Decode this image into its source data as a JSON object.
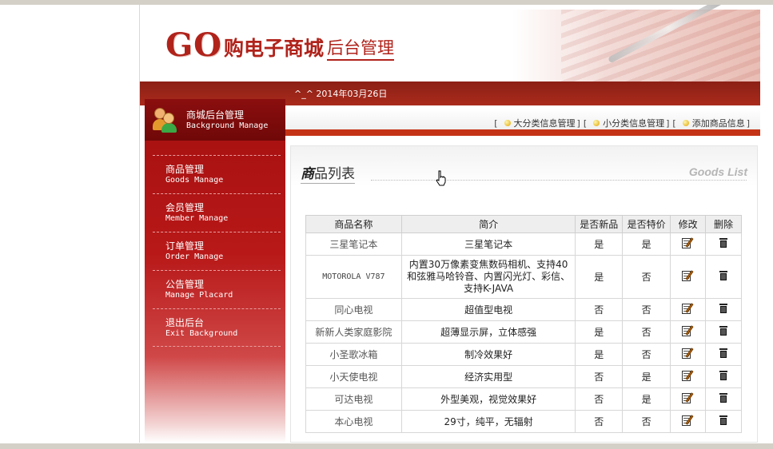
{
  "header": {
    "logo_go": "GO",
    "logo_mall": "购电子商城",
    "logo_admin": "后台管理"
  },
  "topbar": {
    "date": "^_^ 2014年03月26日"
  },
  "sidebar": {
    "title_cn": "商城后台管理",
    "title_en": "Background Manage",
    "items": [
      {
        "cn": "商品管理",
        "en": "Goods Manage"
      },
      {
        "cn": "会员管理",
        "en": "Member Manage"
      },
      {
        "cn": "订单管理",
        "en": "Order Manage"
      },
      {
        "cn": "公告管理",
        "en": "Manage Placard"
      },
      {
        "cn": "退出后台",
        "en": "Exit Background"
      }
    ]
  },
  "actions": {
    "big_category": "大分类信息管理",
    "small_category": "小分类信息管理",
    "add_goods": "添加商品信息"
  },
  "content": {
    "title_bold": "商",
    "title_rest": "品列表",
    "title_en": "Goods List"
  },
  "table": {
    "headers": [
      "商品名称",
      "简介",
      "是否新品",
      "是否特价",
      "修改",
      "删除"
    ],
    "rows": [
      {
        "name": "三星笔记本",
        "intro": "三星笔记本",
        "is_new": "是",
        "is_special": "是"
      },
      {
        "name": "MOTOROLA V787",
        "intro": "内置30万像素变焦数码相机、支持40和弦雅马哈铃音、内置闪光灯、彩信、支持K-JAVA",
        "is_new": "是",
        "is_special": "否"
      },
      {
        "name": "同心电视",
        "intro": "超值型电视",
        "is_new": "否",
        "is_special": "否"
      },
      {
        "name": "新新人类家庭影院",
        "intro": "超薄显示屏，立体感强",
        "is_new": "是",
        "is_special": "否"
      },
      {
        "name": "小圣歌冰箱",
        "intro": "制冷效果好",
        "is_new": "是",
        "is_special": "否"
      },
      {
        "name": "小天使电视",
        "intro": "经济实用型",
        "is_new": "否",
        "is_special": "是"
      },
      {
        "name": "可达电视",
        "intro": "外型美观，视觉效果好",
        "is_new": "否",
        "is_special": "是"
      },
      {
        "name": "本心电视",
        "intro": "29寸，纯平，无辐射",
        "is_new": "否",
        "is_special": "否"
      }
    ]
  },
  "colors": {
    "brand_red": "#b0231b",
    "sidebar_dark": "#8b0e0e",
    "accent_orange": "#c53316"
  }
}
